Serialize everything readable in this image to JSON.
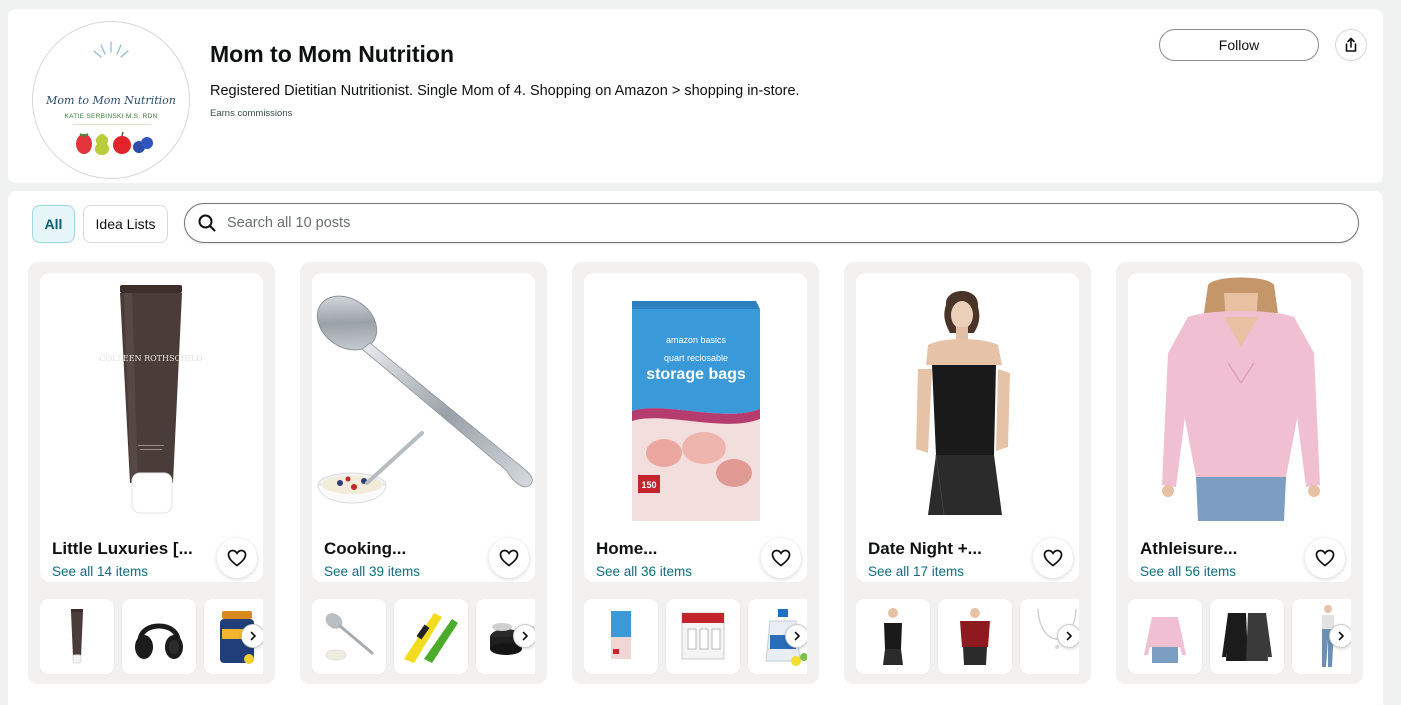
{
  "profile": {
    "name": "Mom to Mom Nutrition",
    "bio": "Registered Dietitian Nutritionist. Single Mom of 4. Shopping on Amazon > shopping in-store.",
    "earns": "Earns commissions",
    "avatar_logo_line1": "Mom to Mom Nutrition",
    "avatar_logo_line2": "KATIE SERBINSKI M.S. RDN",
    "follow_label": "Follow",
    "share_icon": "share-icon"
  },
  "filters": {
    "all_label": "All",
    "idea_lists_label": "Idea Lists",
    "active": "All"
  },
  "search": {
    "placeholder": "Search all 10 posts",
    "icon": "search-icon"
  },
  "colors": {
    "link": "#0f6c7c",
    "active_filter_bg": "#e6f6f8",
    "card_bg": "#f2f1ef",
    "page_bg": "#f0f2f2"
  },
  "lists": [
    {
      "title": "Little Luxuries [...",
      "see_all": "See all 14 items",
      "hero": "tube-cream",
      "thumbs": [
        "tube-cream",
        "headphones",
        "supplement-bottle"
      ]
    },
    {
      "title": "Cooking...",
      "see_all": "See all 39 items",
      "hero": "spoon-and-bowl",
      "thumbs": [
        "spoon",
        "citrus-juicer",
        "cookware-set"
      ]
    },
    {
      "title": "Home...",
      "see_all": "See all 36 items",
      "hero": "storage-bags",
      "thumbs": [
        "storage-bags",
        "command-hooks",
        "vinegar-jug"
      ]
    },
    {
      "title": "Date Night +...",
      "see_all": "See all 17 items",
      "hero": "black-strapless-top",
      "thumbs": [
        "black-strapless-top",
        "red-off-shoulder-top",
        "necklace"
      ]
    },
    {
      "title": "Athleisure...",
      "see_all": "See all 56 items",
      "hero": "pink-long-sleeve-top",
      "thumbs": [
        "pink-long-sleeve-top",
        "black-long-sleeve-tops",
        "jeans"
      ]
    }
  ],
  "hero_text": {
    "tube_brand": "COLLEEN ROTHSCHILD",
    "bags_brand": "amazon basics",
    "bags_sub": "quart reclosable",
    "bags_main": "storage bags",
    "bags_count": "150"
  }
}
